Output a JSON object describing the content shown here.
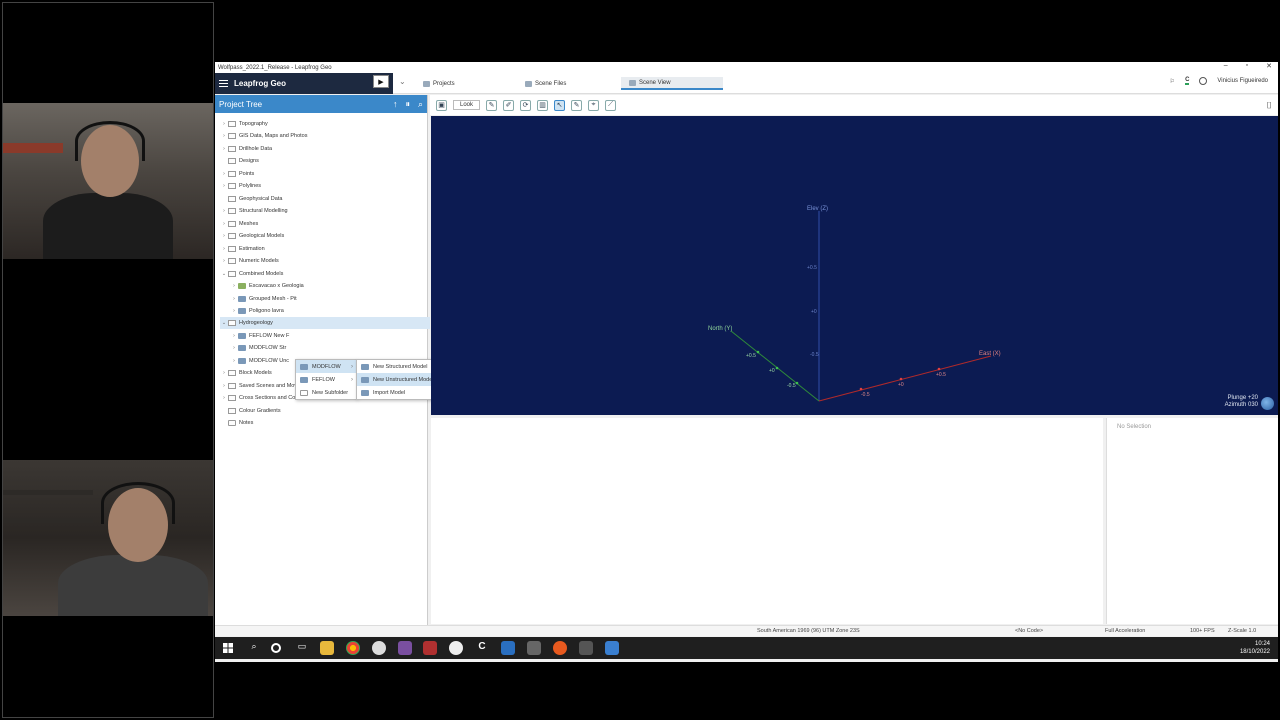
{
  "window": {
    "title": "Wolfpass_2022.1_Release - Leapfrog Geo",
    "controls": [
      "–",
      "▫",
      "✕"
    ]
  },
  "app": {
    "brand": "Leapfrog Geo"
  },
  "tabs": [
    {
      "label": "Projects"
    },
    {
      "label": "Scene Files"
    },
    {
      "label": "Scene View"
    }
  ],
  "user": {
    "name": "Vinicius Figueiredo"
  },
  "tree": {
    "title": "Project Tree",
    "items": [
      {
        "label": "Topography"
      },
      {
        "label": "GIS Data, Maps and Photos"
      },
      {
        "label": "Drillhole Data"
      },
      {
        "label": "Designs"
      },
      {
        "label": "Points"
      },
      {
        "label": "Polylines"
      },
      {
        "label": "Geophysical Data"
      },
      {
        "label": "Structural Modelling"
      },
      {
        "label": "Meshes"
      },
      {
        "label": "Geological Models"
      },
      {
        "label": "Estimation"
      },
      {
        "label": "Numeric Models"
      },
      {
        "label": "Combined Models"
      },
      {
        "label": "Escavacao x Geologia"
      },
      {
        "label": "Grouped Mesh - Pit"
      },
      {
        "label": "Poligono lavra"
      },
      {
        "label": "Hydrogeology"
      },
      {
        "label": "FEFLOW New F"
      },
      {
        "label": "MODFLOW Str"
      },
      {
        "label": "MODFLOW Unc"
      },
      {
        "label": "Block Models"
      },
      {
        "label": "Saved Scenes and Movies"
      },
      {
        "label": "Cross Sections and Contours"
      },
      {
        "label": "Colour Gradients"
      },
      {
        "label": "Notes"
      }
    ]
  },
  "context_menu": {
    "items": [
      {
        "label": "MODFLOW"
      },
      {
        "label": "FEFLOW"
      },
      {
        "label": "New Subfolder"
      }
    ]
  },
  "submenu": {
    "items": [
      {
        "label": "New Structured Model"
      },
      {
        "label": "New Unstructured Model"
      },
      {
        "label": "Import Model"
      }
    ]
  },
  "scene": {
    "look_label": "Look",
    "axis_elev": "Elev (Z)",
    "axis_north": "North (Y)",
    "axis_east": "East (X)",
    "plunge": "Plunge +20",
    "azimuth": "Azimuth 030",
    "ticks": {
      "z1": "+0.5",
      "z2": "+0",
      "z3": "-0.5",
      "n1": "+0.5",
      "n2": "+0",
      "n3": "-0.5",
      "e1": "-0.5",
      "e2": "+0",
      "e3": "+0.5"
    }
  },
  "selection": {
    "label": "No Selection"
  },
  "status": {
    "crs": "South American 1969 (96) UTM Zone 23S",
    "code": "<No Code>",
    "accel": "Full Acceleration",
    "fps": "100+ FPS",
    "zscale": "Z-Scale 1.0"
  },
  "clock": {
    "time": "10:24",
    "date": "18/10/2022"
  }
}
